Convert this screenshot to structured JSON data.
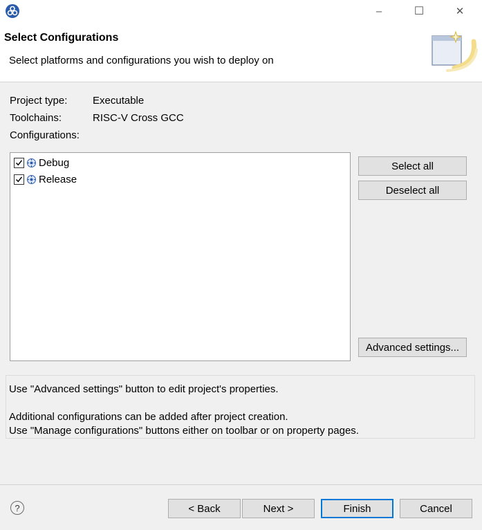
{
  "window": {
    "minimize_glyph": "–",
    "maximize_glyph": "☐",
    "close_glyph": "✕"
  },
  "header": {
    "title": "Select Configurations",
    "description": "Select platforms and configurations you wish to deploy on"
  },
  "project": {
    "type_label": "Project type:",
    "type_value": "Executable",
    "toolchains_label": "Toolchains:",
    "toolchains_value": "RISC-V Cross GCC",
    "configurations_label": "Configurations:"
  },
  "configurations": [
    {
      "label": "Debug",
      "checked": true
    },
    {
      "label": "Release",
      "checked": true
    }
  ],
  "side_buttons": {
    "select_all": "Select all",
    "deselect_all": "Deselect all",
    "advanced": "Advanced settings..."
  },
  "info": {
    "line1": "Use \"Advanced settings\" button to edit project's properties.",
    "line2": "Additional configurations can be added after project creation.",
    "line3": "Use \"Manage configurations\" buttons either on toolbar or on property pages."
  },
  "footer": {
    "help_glyph": "?",
    "back": "< Back",
    "next": "Next >",
    "finish": "Finish",
    "cancel": "Cancel"
  },
  "colors": {
    "accent": "#0078d7",
    "app_icon": "#2b5cab"
  }
}
